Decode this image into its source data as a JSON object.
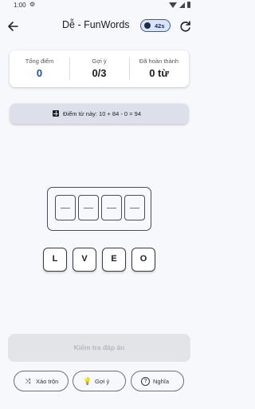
{
  "status_bar": {
    "time": "1:00"
  },
  "header": {
    "title": "Dễ - FunWords",
    "timer": "42s"
  },
  "stats": [
    {
      "label": "Tổng điểm",
      "value": "0"
    },
    {
      "label": "Gợi ý",
      "value": "0/3"
    },
    {
      "label": "Đã hoàn thành",
      "value": "0 từ"
    }
  ],
  "formula": {
    "text": "Điểm từ này: 10 + 84 - 0 = 94"
  },
  "slots": {
    "placeholders": [
      "—",
      "—",
      "—",
      "—"
    ]
  },
  "letters": [
    "L",
    "V",
    "E",
    "O"
  ],
  "check_button": {
    "label": "Kiểm tra đáp án"
  },
  "actions": [
    {
      "label": "Xáo trộn",
      "icon": "shuffle-icon"
    },
    {
      "label": "Gợi ý",
      "icon": "lightbulb-icon"
    },
    {
      "label": "Nghĩa",
      "icon": "question-icon"
    }
  ],
  "colors": {
    "accent": "#1f4e8c",
    "badge_bg": "#d9e4fb",
    "background": "#f7f8fc"
  }
}
